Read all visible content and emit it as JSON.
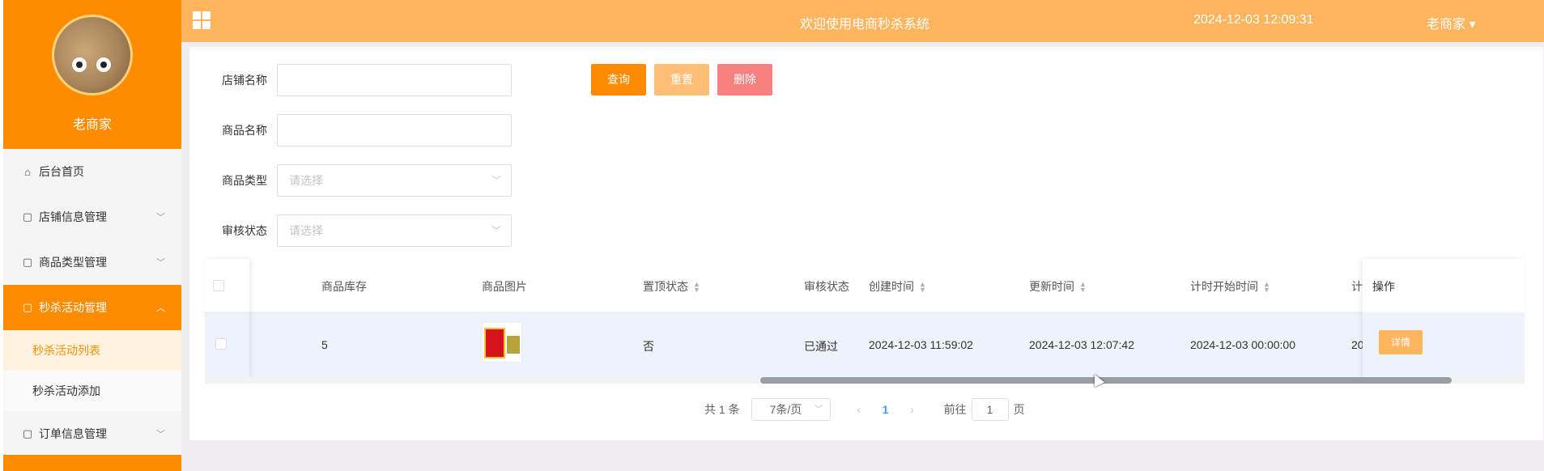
{
  "sidebar": {
    "profile_name": "老商家",
    "items": [
      {
        "label": "后台首页",
        "icon": "home-icon"
      },
      {
        "label": "店铺信息管理",
        "icon": "doc-icon"
      },
      {
        "label": "商品类型管理",
        "icon": "doc-icon"
      },
      {
        "label": "秒杀活动管理",
        "icon": "doc-icon",
        "active": true
      },
      {
        "label": "订单信息管理",
        "icon": "doc-icon"
      }
    ],
    "subitems": [
      {
        "label": "秒杀活动列表",
        "current": true
      },
      {
        "label": "秒杀活动添加"
      }
    ]
  },
  "header": {
    "title": "欢迎使用电商秒杀系统",
    "datetime": "2024-12-03 12:09:31",
    "user": "老商家 ▾"
  },
  "search": {
    "shop_name_label": "店铺名称",
    "shop_name_value": "",
    "product_name_label": "商品名称",
    "product_name_value": "",
    "product_type_label": "商品类型",
    "product_type_placeholder": "请选择",
    "review_status_label": "审核状态",
    "review_status_placeholder": "请选择",
    "query_button": "查询",
    "reset_button": "重置",
    "delete_button": "删除"
  },
  "table": {
    "columns": [
      "商品库存",
      "商品图片",
      "置顶状态",
      "审核状态",
      "创建时间",
      "更新时间",
      "计时开始时间",
      "计",
      "操作"
    ],
    "rows": [
      {
        "stock": "5",
        "pinned": "否",
        "review": "已通过",
        "created": "2024-12-03 11:59:02",
        "updated": "2024-12-03 12:07:42",
        "start": "2024-12-03 00:00:00",
        "truncated": "20",
        "action": "详情"
      }
    ]
  },
  "pagination": {
    "total": "共 1 条",
    "page_size": "7条/页",
    "current_page": "1",
    "goto_label": "前往",
    "goto_value": "1",
    "page_suffix": "页"
  },
  "colors": {
    "accent": "#ff8c00",
    "header": "#ffb45e",
    "delete": "#f78080"
  }
}
